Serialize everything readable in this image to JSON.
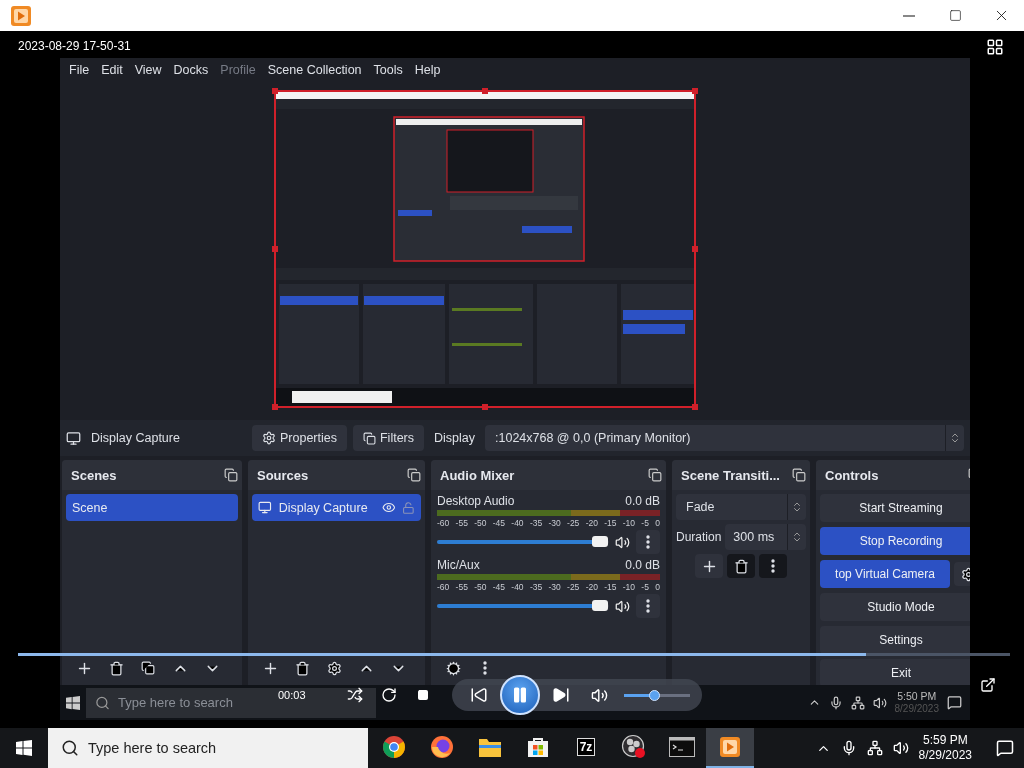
{
  "player": {
    "filename": "2023-08-29 17-50-31",
    "elapsed": "00:03",
    "playing": true,
    "progress": {
      "level": 0.855
    },
    "volume": {
      "level": 0.45
    }
  },
  "obs": {
    "menu": [
      {
        "label": "File",
        "disabled": false
      },
      {
        "label": "Edit",
        "disabled": false
      },
      {
        "label": "View",
        "disabled": false
      },
      {
        "label": "Docks",
        "disabled": false
      },
      {
        "label": "Profile",
        "disabled": true
      },
      {
        "label": "Scene Collection",
        "disabled": false
      },
      {
        "label": "Tools",
        "disabled": false
      },
      {
        "label": "Help",
        "disabled": false
      }
    ],
    "source_toolbar": {
      "source": "Display Capture",
      "properties": "Properties",
      "filters": "Filters",
      "display_label": "Display",
      "display_value": ":1024x768 @ 0,0 (Primary Monitor)"
    },
    "scenes": {
      "title": "Scenes",
      "items": [
        {
          "label": "Scene",
          "selected": true
        }
      ]
    },
    "sources": {
      "title": "Sources",
      "items": [
        {
          "label": "Display Capture",
          "selected": true,
          "visible": true,
          "locked": false
        }
      ]
    },
    "audio_mixer": {
      "title": "Audio Mixer",
      "channels": [
        {
          "name": "Desktop Audio",
          "reading": "0.0 dB",
          "scale": [
            "-60",
            "-55",
            "-50",
            "-45",
            "-40",
            "-35",
            "-30",
            "-25",
            "-20",
            "-15",
            "-10",
            "-5",
            "0"
          ],
          "level": 0.95
        },
        {
          "name": "Mic/Aux",
          "reading": "0.0 dB",
          "scale": [
            "-60",
            "-55",
            "-50",
            "-45",
            "-40",
            "-35",
            "-30",
            "-25",
            "-20",
            "-15",
            "-10",
            "-5",
            "0"
          ],
          "level": 0.95
        }
      ]
    },
    "scene_transitions": {
      "title": "Scene Transiti...",
      "transition": "Fade",
      "duration_label": "Duration",
      "duration": "300 ms"
    },
    "controls": {
      "title": "Controls",
      "buttons": [
        {
          "label": "Start Streaming",
          "active": false,
          "kind": "plain"
        },
        {
          "label": "Stop Recording",
          "active": true,
          "kind": "plain"
        },
        {
          "label": "top Virtual Camera",
          "active": true,
          "kind": "with_settings"
        },
        {
          "label": "Studio Mode",
          "active": false,
          "kind": "plain"
        },
        {
          "label": "Settings",
          "active": false,
          "kind": "plain"
        },
        {
          "label": "Exit",
          "active": false,
          "kind": "plain"
        }
      ]
    }
  },
  "video_taskbar": {
    "search_placeholder": "Type here to search",
    "time": "5:50 PM",
    "date": "8/29/2023"
  },
  "taskbar": {
    "search_placeholder": "Type here to search",
    "apps": [
      {
        "kind": "chrome",
        "active": false
      },
      {
        "kind": "firefox",
        "active": false
      },
      {
        "kind": "explorer",
        "active": false
      },
      {
        "kind": "store",
        "active": false
      },
      {
        "kind": "archiver",
        "label": "7z",
        "active": false
      },
      {
        "kind": "obs",
        "active": false
      },
      {
        "kind": "terminal",
        "active": false
      },
      {
        "kind": "player",
        "active": true
      }
    ],
    "time": "5:59 PM",
    "date": "8/29/2023"
  }
}
